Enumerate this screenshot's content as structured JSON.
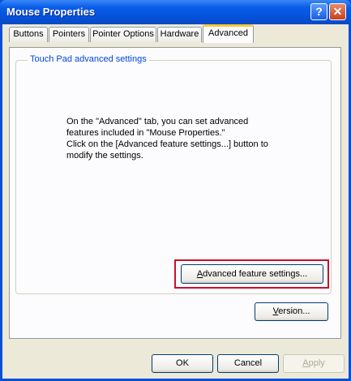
{
  "window": {
    "title": "Mouse Properties",
    "help_glyph": "?",
    "close_glyph": "✕"
  },
  "tabs": [
    {
      "label": "Buttons",
      "active": false
    },
    {
      "label": "Pointers",
      "active": false
    },
    {
      "label": "Pointer Options",
      "active": false
    },
    {
      "label": "Hardware",
      "active": false
    },
    {
      "label": "Advanced",
      "active": true
    }
  ],
  "group": {
    "label": "Touch Pad advanced settings"
  },
  "message": {
    "line1": "On the \"Advanced\" tab, you can set advanced",
    "line2": "features included in \"Mouse Properties.\"",
    "line3": "Click on the [Advanced feature settings...] button to",
    "line4": "modify the settings."
  },
  "buttons": {
    "advanced_prefix": "",
    "advanced_mnemonic": "A",
    "advanced_rest": "dvanced feature settings...",
    "version_mnemonic": "V",
    "version_rest": "ersion...",
    "ok": "OK",
    "cancel": "Cancel",
    "apply_mnemonic": "A",
    "apply_rest": "pply"
  },
  "colors": {
    "highlight": "#c8102e",
    "group_label": "#0046d5",
    "active_tab_accent": "#ffc83c"
  }
}
